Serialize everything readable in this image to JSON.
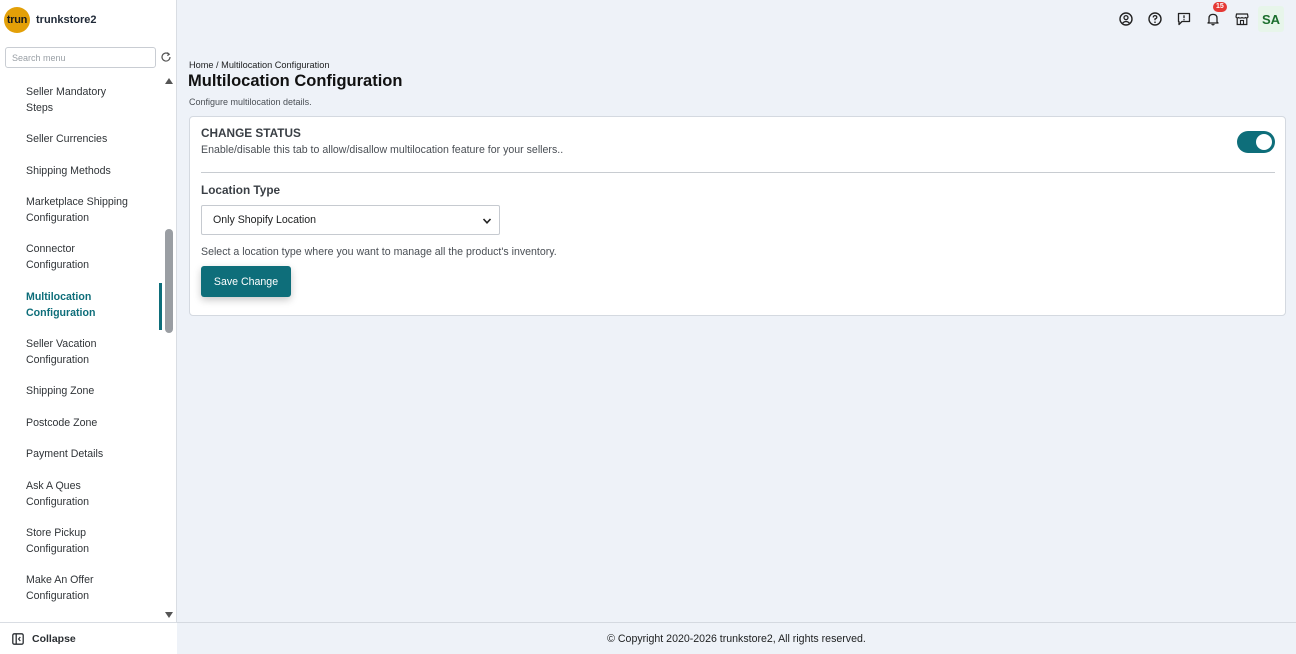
{
  "brand": {
    "logo_text": "trun",
    "name": "trunkstore2",
    "logo_color": "#e3a008"
  },
  "search": {
    "placeholder": "Search menu",
    "value": ""
  },
  "sidebar": {
    "items": [
      {
        "line1": "Seller Mandatory",
        "line2": "Steps",
        "active": false
      },
      {
        "line1": "Seller Currencies",
        "line2": "",
        "active": false
      },
      {
        "line1": "Shipping Methods",
        "line2": "",
        "active": false
      },
      {
        "line1": "Marketplace Shipping",
        "line2": "Configuration",
        "active": false
      },
      {
        "line1": "Connector",
        "line2": "Configuration",
        "active": false
      },
      {
        "line1": "Multilocation",
        "line2": "Configuration",
        "active": true
      },
      {
        "line1": "Seller Vacation",
        "line2": "Configuration",
        "active": false
      },
      {
        "line1": "Shipping Zone",
        "line2": "",
        "active": false
      },
      {
        "line1": "Postcode Zone",
        "line2": "",
        "active": false
      },
      {
        "line1": "Payment Details",
        "line2": "",
        "active": false
      },
      {
        "line1": "Ask A Ques",
        "line2": "Configuration",
        "active": false
      },
      {
        "line1": "Store Pickup",
        "line2": "Configuration",
        "active": false
      },
      {
        "line1": "Make An Offer",
        "line2": "Configuration",
        "active": false
      }
    ],
    "collapse_label": "Collapse"
  },
  "topbar": {
    "icons": [
      "account-circle-icon",
      "help-icon",
      "feedback-icon",
      "bell-icon",
      "store-icon"
    ],
    "notification_count": "15",
    "avatar_initials": "SA"
  },
  "page": {
    "breadcrumb": "Home / Multilocation Configuration",
    "title": "Multilocation Configuration",
    "subtitle": "Configure multilocation details."
  },
  "card": {
    "change_status_title": "CHANGE STATUS",
    "change_status_desc": "Enable/disable this tab to allow/disallow multilocation feature for your sellers..",
    "toggle_on": true,
    "location_type_label": "Location Type",
    "location_type_value": "Only Shopify Location",
    "location_type_help": "Select a location type where you want to manage all the product's inventory.",
    "save_label": "Save Change"
  },
  "footer": {
    "text": "© Copyright 2020-2026 trunkstore2, All rights reserved."
  },
  "colors": {
    "accent": "#0e6e7a",
    "badge": "#e53935",
    "background": "#eef2f8"
  }
}
